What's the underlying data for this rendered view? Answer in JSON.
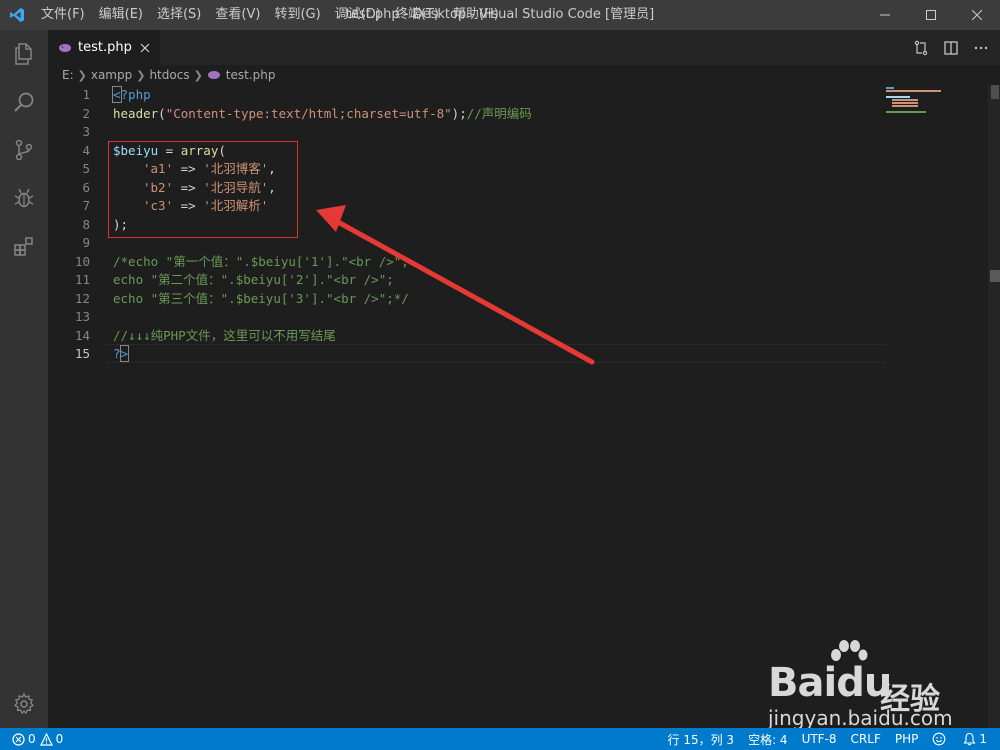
{
  "titlebar": {
    "menus": [
      "文件(F)",
      "编辑(E)",
      "选择(S)",
      "查看(V)",
      "转到(G)",
      "调试(D)",
      "终端(T)",
      "帮助(H)"
    ],
    "window_title": "test.php - Desktop - Visual Studio Code [管理员]"
  },
  "activitybar": {
    "icons": [
      "files-icon",
      "search-icon",
      "source-control-icon",
      "debug-icon",
      "extensions-icon",
      "settings-gear-icon"
    ]
  },
  "tabs": [
    {
      "label": "test.php",
      "icon": "php-elephant-icon",
      "active": true
    }
  ],
  "breadcrumb": [
    "E:",
    "xampp",
    "htdocs",
    "test.php"
  ],
  "editor": {
    "line_numbers": [
      "1",
      "2",
      "3",
      "4",
      "5",
      "6",
      "7",
      "8",
      "9",
      "10",
      "11",
      "12",
      "13",
      "14",
      "15"
    ],
    "current_line": 15,
    "lines": {
      "l1_open": "<",
      "l1_rest": "?php",
      "l2_fn": "header",
      "l2_p1": "(",
      "l2_str": "\"Content-type:text/html;charset=utf-8\"",
      "l2_p2": ");",
      "l2_com": "//声明编码",
      "l4_var": "$beiyu",
      "l4_op": " = ",
      "l4_fn": "array",
      "l4_p": "(",
      "l5_k": "'a1'",
      "l5_op": " => ",
      "l5_v": "'北羽博客'",
      "l5_end": ",",
      "l6_k": "'b2'",
      "l6_op": " => ",
      "l6_v": "'北羽导航'",
      "l6_end": ",",
      "l7_k": "'c3'",
      "l7_op": " => ",
      "l7_v": "'北羽解析'",
      "l8": ");",
      "l10": "/*echo \"第一个值：\".$beiyu['1'].\"<br />\";",
      "l11": "echo \"第二个值：\".$beiyu['2'].\"<br />\";",
      "l12": "echo \"第三个值：\".$beiyu['3'].\"<br />\";*/",
      "l14": "//↓↓↓纯PHP文件，这里可以不用写结尾",
      "l15_q": "?",
      "l15_close": ">"
    }
  },
  "watermark": {
    "brand": "Baidu",
    "product": "经验",
    "url": "jingyan.baidu.com"
  },
  "statusbar": {
    "errors": "0",
    "warnings": "0",
    "position": "行 15，列 3",
    "indent": "空格: 4",
    "encoding": "UTF-8",
    "eol": "CRLF",
    "language": "PHP",
    "notifications": "1"
  },
  "colors": {
    "accent": "#007acc",
    "highlight_box": "#e03030",
    "annotation_arrow": "#e53935"
  }
}
